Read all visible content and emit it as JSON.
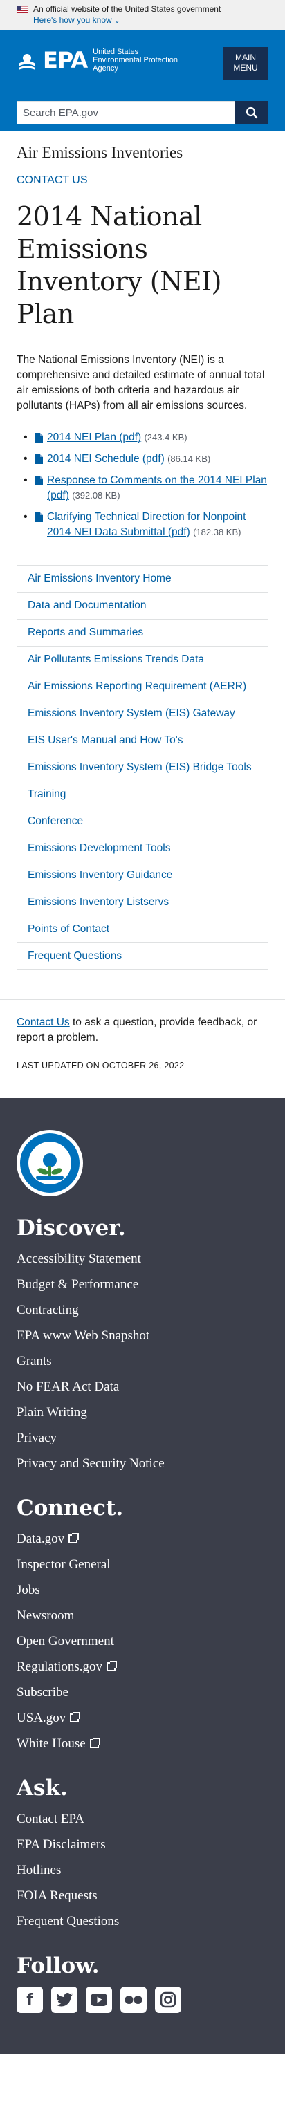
{
  "gov_banner": {
    "text": "An official website of the United States government",
    "how_you_know": "Here's how you know"
  },
  "header": {
    "logo_text": "EPA",
    "agency_name": "United States Environmental Protection Agency",
    "menu_label_1": "MAIN",
    "menu_label_2": "MENU",
    "search_placeholder": "Search EPA.gov",
    "brand_color": "#0071bc"
  },
  "main": {
    "section_title": "Air Emissions Inventories",
    "contact_link": "CONTACT US",
    "page_title": "2014 National Emissions Inventory (NEI) Plan",
    "intro": "The National Emissions Inventory (NEI) is a comprehensive and detailed estimate of annual total air emissions of both criteria and hazardous air pollutants (HAPs) from all air emissions sources.",
    "documents": [
      {
        "label": "2014 NEI Plan (pdf)",
        "size": "(243.4 KB)"
      },
      {
        "label": "2014 NEI Schedule (pdf)",
        "size": "(86.14 KB)"
      },
      {
        "label": "Response to Comments on the 2014 NEI Plan (pdf)",
        "size": "(392.08 KB)"
      },
      {
        "label": "Clarifying Technical Direction for Nonpoint 2014 NEI Data Submittal (pdf)",
        "size": "(182.38 KB)"
      }
    ],
    "side_nav": [
      "Air Emissions Inventory Home",
      "Data and Documentation",
      "Reports and Summaries",
      "Air Pollutants Emissions Trends Data",
      "Air Emissions Reporting Requirement (AERR)",
      "Emissions Inventory System (EIS) Gateway",
      "EIS User's Manual and How To's",
      "Emissions Inventory System (EIS) Bridge Tools",
      "Training",
      "Conference",
      "Emissions Development Tools",
      "Emissions Inventory Guidance",
      "Emissions Inventory Listservs",
      "Points of Contact",
      "Frequent Questions"
    ],
    "contact_block_link": "Contact Us",
    "contact_block_text": " to ask a question, provide feedback, or report a problem.",
    "last_updated": "LAST UPDATED ON OCTOBER 26, 2022"
  },
  "footer": {
    "discover": {
      "heading": "Discover.",
      "items": [
        "Accessibility Statement",
        "Budget & Performance",
        "Contracting",
        "EPA www Web Snapshot",
        "Grants",
        "No FEAR Act Data",
        "Plain Writing",
        "Privacy",
        "Privacy and Security Notice"
      ]
    },
    "connect": {
      "heading": "Connect.",
      "items": [
        "Data.gov",
        "Inspector General",
        "Jobs",
        "Newsroom",
        "Open Government",
        "Regulations.gov",
        "Subscribe",
        "USA.gov",
        "White House"
      ]
    },
    "ask": {
      "heading": "Ask.",
      "items": [
        "Contact EPA",
        "EPA Disclaimers",
        "Hotlines",
        "FOIA Requests",
        "Frequent Questions"
      ]
    },
    "follow": {
      "heading": "Follow.",
      "icons": [
        "facebook-icon",
        "twitter-icon",
        "youtube-icon",
        "flickr-icon",
        "instagram-icon"
      ]
    },
    "background_color": "#3b3e4a"
  }
}
